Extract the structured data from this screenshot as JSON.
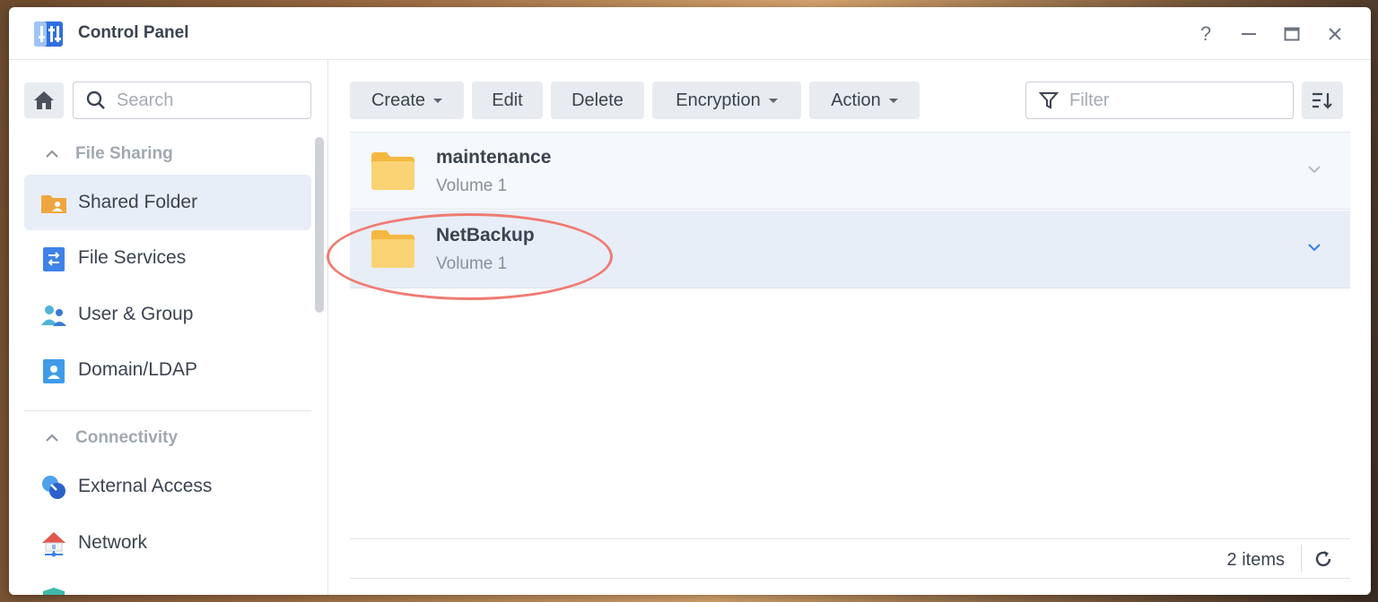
{
  "window": {
    "title": "Control Panel",
    "help_label": "?"
  },
  "sidebar": {
    "search_placeholder": "Search",
    "sections": [
      {
        "label": "File Sharing",
        "items": [
          {
            "label": "Shared Folder",
            "icon": "shared-folder-icon",
            "active": true
          },
          {
            "label": "File Services",
            "icon": "file-services-icon"
          },
          {
            "label": "User & Group",
            "icon": "user-group-icon"
          },
          {
            "label": "Domain/LDAP",
            "icon": "domain-ldap-icon"
          }
        ]
      },
      {
        "label": "Connectivity",
        "items": [
          {
            "label": "External Access",
            "icon": "external-access-icon"
          },
          {
            "label": "Network",
            "icon": "network-icon"
          }
        ]
      }
    ]
  },
  "toolbar": {
    "create_label": "Create",
    "edit_label": "Edit",
    "delete_label": "Delete",
    "encryption_label": "Encryption",
    "action_label": "Action",
    "filter_placeholder": "Filter"
  },
  "folders": [
    {
      "name": "maintenance",
      "volume": "Volume 1"
    },
    {
      "name": "NetBackup",
      "volume": "Volume 1",
      "selected": true
    }
  ],
  "footer": {
    "item_count": "2 items"
  },
  "colors": {
    "accent": "#2f7ff0",
    "highlight_ring": "#ef7b72",
    "folder": "#f7c75a",
    "selected_row": "#e8eef7"
  }
}
